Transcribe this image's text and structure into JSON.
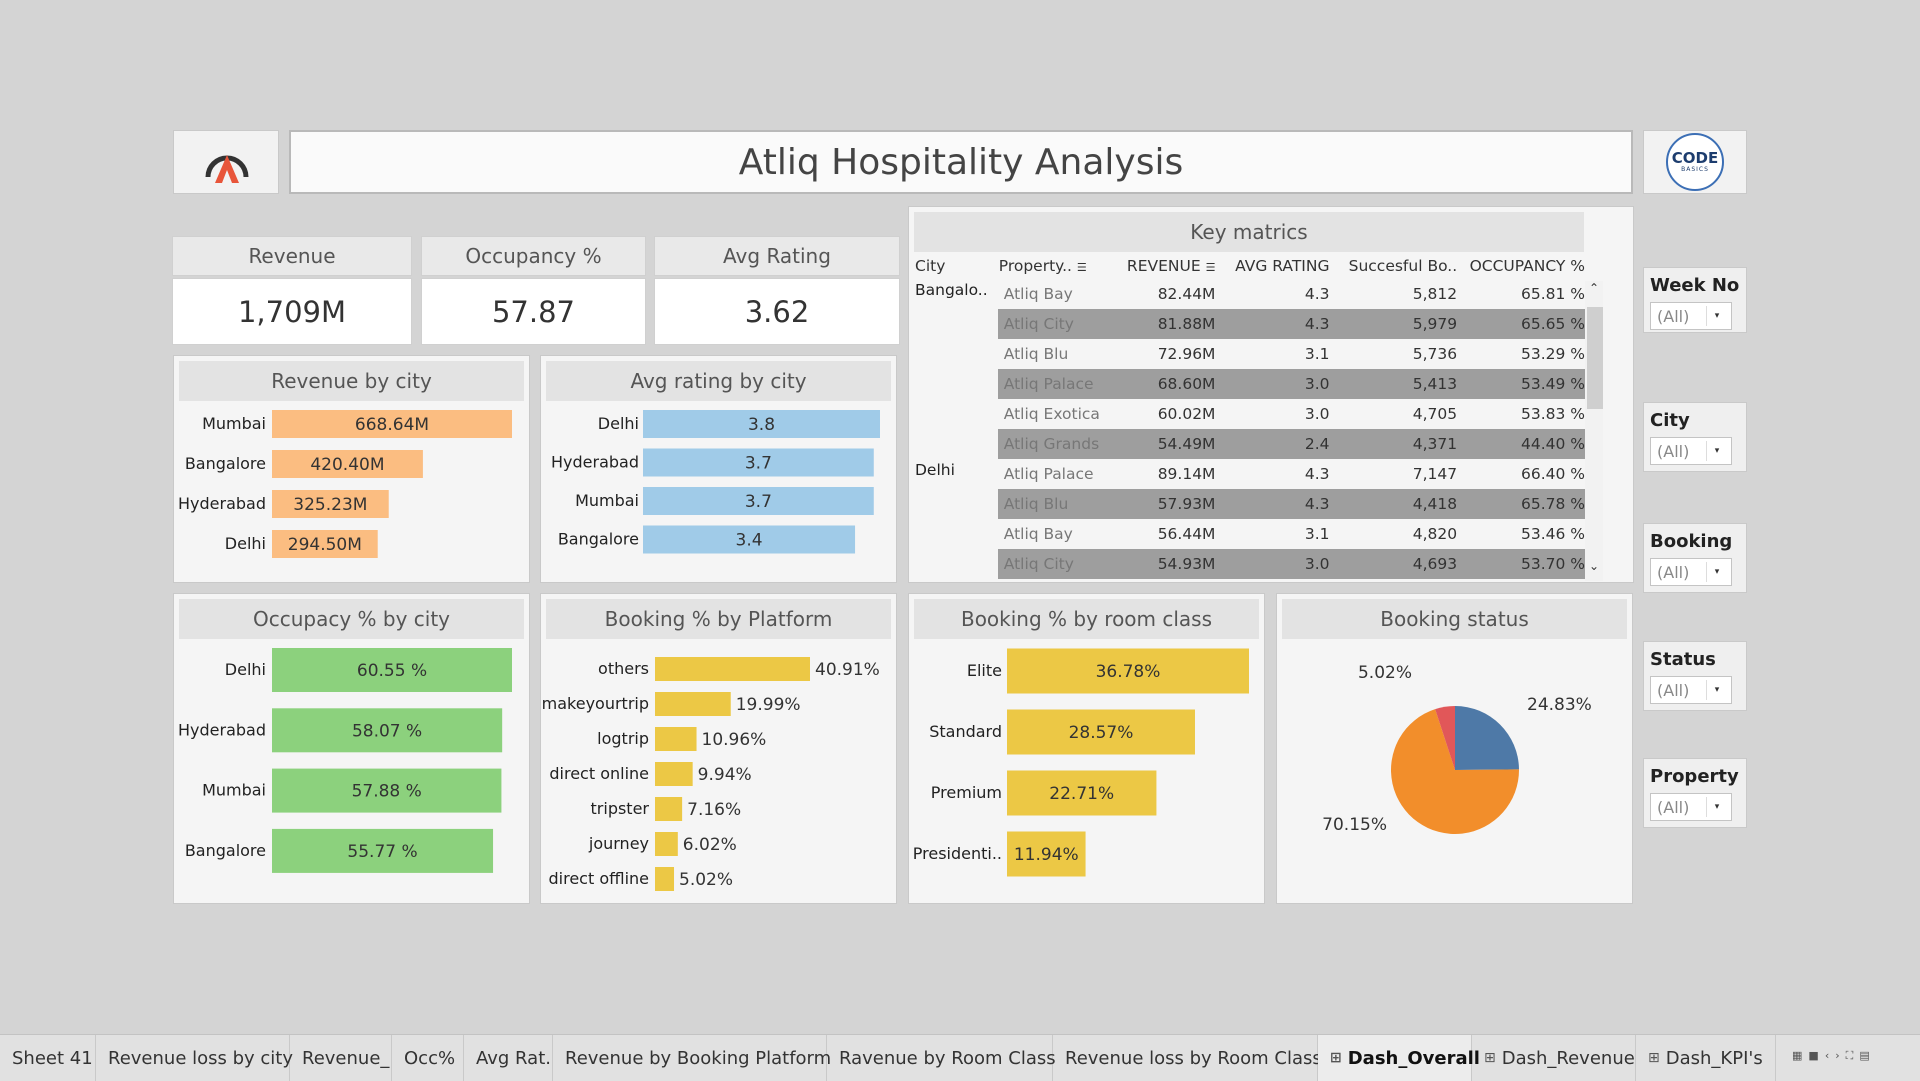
{
  "header": {
    "title": "Atliq Hospitality Analysis",
    "left_logo": "atliq-logo",
    "right_logo_text_top": "CODE",
    "right_logo_text_bottom": "BASICS"
  },
  "kpis": [
    {
      "label": "Revenue",
      "value": "1,709M"
    },
    {
      "label": "Occupancy %",
      "value": "57.87"
    },
    {
      "label": "Avg Rating",
      "value": "3.62"
    }
  ],
  "revenue_by_city": {
    "title": "Revenue by city",
    "color": "#fbbd81",
    "rows": [
      {
        "city": "Mumbai",
        "label": "668.64M",
        "value": 668.64
      },
      {
        "city": "Bangalore",
        "label": "420.40M",
        "value": 420.4
      },
      {
        "city": "Hyderabad",
        "label": "325.23M",
        "value": 325.23
      },
      {
        "city": "Delhi",
        "label": "294.50M",
        "value": 294.5
      }
    ]
  },
  "avg_rating_by_city": {
    "title": "Avg rating by city",
    "color": "#a0cbe8",
    "rows": [
      {
        "city": "Delhi",
        "label": "3.8",
        "value": 3.8
      },
      {
        "city": "Hyderabad",
        "label": "3.7",
        "value": 3.7
      },
      {
        "city": "Mumbai",
        "label": "3.7",
        "value": 3.7
      },
      {
        "city": "Bangalore",
        "label": "3.4",
        "value": 3.4
      }
    ]
  },
  "key_metrics": {
    "title": "Key matrics",
    "columns": [
      "City",
      "Property..",
      "REVENUE",
      "AVG RATING",
      "Succesful Bo..",
      "OCCUPANCY %"
    ],
    "rows": [
      {
        "city": "Bangalo..",
        "property": "Atliq Bay",
        "revenue": "82.44M",
        "rating": "4.3",
        "bookings": "5,812",
        "occupancy": "65.81 %"
      },
      {
        "city": "",
        "property": "Atliq City",
        "revenue": "81.88M",
        "rating": "4.3",
        "bookings": "5,979",
        "occupancy": "65.65 %"
      },
      {
        "city": "",
        "property": "Atliq Blu",
        "revenue": "72.96M",
        "rating": "3.1",
        "bookings": "5,736",
        "occupancy": "53.29 %"
      },
      {
        "city": "",
        "property": "Atliq Palace",
        "revenue": "68.60M",
        "rating": "3.0",
        "bookings": "5,413",
        "occupancy": "53.49 %"
      },
      {
        "city": "",
        "property": "Atliq Exotica",
        "revenue": "60.02M",
        "rating": "3.0",
        "bookings": "4,705",
        "occupancy": "53.83 %"
      },
      {
        "city": "",
        "property": "Atliq Grands",
        "revenue": "54.49M",
        "rating": "2.4",
        "bookings": "4,371",
        "occupancy": "44.40 %"
      },
      {
        "city": "Delhi",
        "property": "Atliq Palace",
        "revenue": "89.14M",
        "rating": "4.3",
        "bookings": "7,147",
        "occupancy": "66.40 %"
      },
      {
        "city": "",
        "property": "Atliq Blu",
        "revenue": "57.93M",
        "rating": "4.3",
        "bookings": "4,418",
        "occupancy": "65.78 %"
      },
      {
        "city": "",
        "property": "Atliq Bay",
        "revenue": "56.44M",
        "rating": "3.1",
        "bookings": "4,820",
        "occupancy": "53.46 %"
      },
      {
        "city": "",
        "property": "Atliq City",
        "revenue": "54.93M",
        "rating": "3.0",
        "bookings": "4,693",
        "occupancy": "53.70 %"
      }
    ]
  },
  "occupancy_by_city": {
    "title": "Occupacy % by city",
    "color": "#8cd17d",
    "rows": [
      {
        "city": "Delhi",
        "label": "60.55 %",
        "value": 60.55
      },
      {
        "city": "Hyderabad",
        "label": "58.07 %",
        "value": 58.07
      },
      {
        "city": "Mumbai",
        "label": "57.88 %",
        "value": 57.88
      },
      {
        "city": "Bangalore",
        "label": "55.77 %",
        "value": 55.77
      }
    ]
  },
  "booking_by_platform": {
    "title": "Booking % by Platform",
    "color": "#ecc845",
    "rows": [
      {
        "platform": "others",
        "label": "40.91%",
        "value": 40.91
      },
      {
        "platform": "makeyourtrip",
        "label": "19.99%",
        "value": 19.99
      },
      {
        "platform": "logtrip",
        "label": "10.96%",
        "value": 10.96
      },
      {
        "platform": "direct online",
        "label": "9.94%",
        "value": 9.94
      },
      {
        "platform": "tripster",
        "label": "7.16%",
        "value": 7.16
      },
      {
        "platform": "journey",
        "label": "6.02%",
        "value": 6.02
      },
      {
        "platform": "direct offline",
        "label": "5.02%",
        "value": 5.02
      }
    ]
  },
  "booking_by_room_class": {
    "title": "Booking % by room class",
    "color": "#ecc845",
    "rows": [
      {
        "class": "Elite",
        "label": "36.78%",
        "value": 36.78
      },
      {
        "class": "Standard",
        "label": "28.57%",
        "value": 28.57
      },
      {
        "class": "Premium",
        "label": "22.71%",
        "value": 22.71
      },
      {
        "class": "Presidenti..",
        "label": "11.94%",
        "value": 11.94
      }
    ]
  },
  "booking_status": {
    "title": "Booking status",
    "slices": [
      {
        "label": "24.83%",
        "value": 24.83,
        "color": "#4e79a7"
      },
      {
        "label": "70.15%",
        "value": 70.15,
        "color": "#f28e2b"
      },
      {
        "label": "5.02%",
        "value": 5.02,
        "color": "#e15759"
      }
    ]
  },
  "filters": [
    {
      "title": "Week No",
      "value": "(All)"
    },
    {
      "title": "City",
      "value": "(All)"
    },
    {
      "title": "Booking ..",
      "value": "(All)"
    },
    {
      "title": "Status",
      "value": "(All)"
    },
    {
      "title": "Property",
      "value": "(All)"
    }
  ],
  "tabs": [
    {
      "label": "Sheet 41",
      "icon": false,
      "active": false
    },
    {
      "label": "Revenue loss by city",
      "icon": false,
      "active": false
    },
    {
      "label": "Revenue_",
      "icon": false,
      "active": false
    },
    {
      "label": "Occ%",
      "icon": false,
      "active": false
    },
    {
      "label": "Avg Rat.",
      "icon": false,
      "active": false
    },
    {
      "label": "Revenue by Booking Platform",
      "icon": false,
      "active": false
    },
    {
      "label": "Ravenue by Room Class",
      "icon": false,
      "active": false
    },
    {
      "label": "Revenue loss by Room Class",
      "icon": false,
      "active": false
    },
    {
      "label": "Dash_Overall",
      "icon": true,
      "active": true
    },
    {
      "label": "Dash_Revenue",
      "icon": true,
      "active": false
    },
    {
      "label": "Dash_KPI's",
      "icon": true,
      "active": false
    }
  ],
  "chart_data": [
    {
      "type": "bar",
      "title": "Revenue by city",
      "categories": [
        "Mumbai",
        "Bangalore",
        "Hyderabad",
        "Delhi"
      ],
      "values": [
        668.64,
        420.4,
        325.23,
        294.5
      ]
    },
    {
      "type": "bar",
      "title": "Avg rating by city",
      "categories": [
        "Delhi",
        "Hyderabad",
        "Mumbai",
        "Bangalore"
      ],
      "values": [
        3.8,
        3.7,
        3.7,
        3.4
      ]
    },
    {
      "type": "bar",
      "title": "Occupacy % by city",
      "categories": [
        "Delhi",
        "Hyderabad",
        "Mumbai",
        "Bangalore"
      ],
      "values": [
        60.55,
        58.07,
        57.88,
        55.77
      ]
    },
    {
      "type": "bar",
      "title": "Booking % by Platform",
      "categories": [
        "others",
        "makeyourtrip",
        "logtrip",
        "direct online",
        "tripster",
        "journey",
        "direct offline"
      ],
      "values": [
        40.91,
        19.99,
        10.96,
        9.94,
        7.16,
        6.02,
        5.02
      ]
    },
    {
      "type": "bar",
      "title": "Booking % by room class",
      "categories": [
        "Elite",
        "Standard",
        "Premium",
        "Presidenti.."
      ],
      "values": [
        36.78,
        28.57,
        22.71,
        11.94
      ]
    },
    {
      "type": "pie",
      "title": "Booking status",
      "values": [
        24.83,
        70.15,
        5.02
      ]
    }
  ]
}
